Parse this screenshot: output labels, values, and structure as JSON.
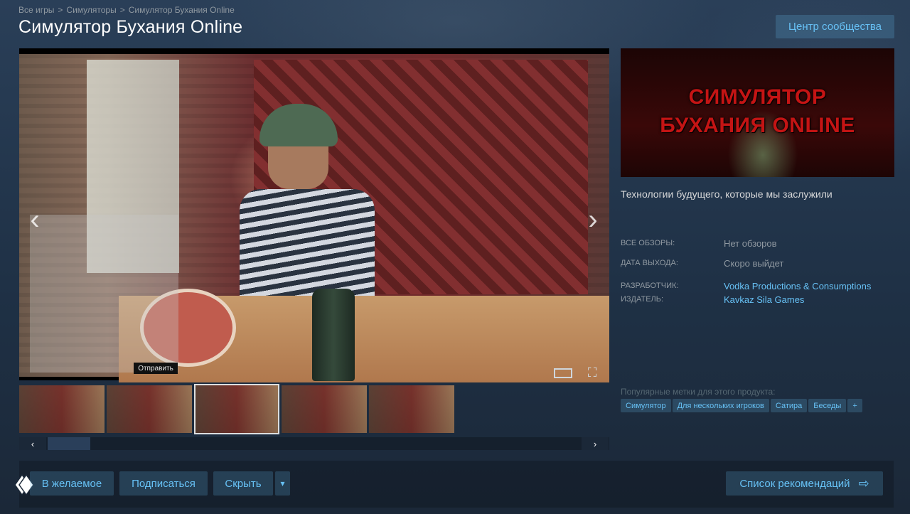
{
  "breadcrumb": {
    "items": [
      "Все игры",
      "Симуляторы",
      "Симулятор Бухания Online"
    ],
    "separator": ">"
  },
  "page_title": "Симулятор Бухания Online",
  "community_button": "Центр сообщества",
  "player": {
    "send_label": "Отправить",
    "nav_prev_icon": "‹",
    "nav_next_icon": "›",
    "fullscreen_icon": "⛶"
  },
  "thumbnails": {
    "count": 5,
    "active_index": 2
  },
  "scroll": {
    "left_icon": "‹",
    "right_icon": "›"
  },
  "capsule": {
    "line1": "СИМУЛЯТОР",
    "line2": "БУХАНИЯ ONLINE"
  },
  "description": "Технологии будущего, которые мы заслужили",
  "info": {
    "reviews_label": "ВСЕ ОБЗОРЫ:",
    "reviews_value": "Нет обзоров",
    "release_label": "ДАТА ВЫХОДА:",
    "release_value": "Скоро выйдет",
    "developer_label": "РАЗРАБОТЧИК:",
    "developer_value": "Vodka Productions & Consumptions",
    "publisher_label": "ИЗДАТЕЛЬ:",
    "publisher_value": "Kavkaz Sila Games"
  },
  "tags": {
    "title": "Популярные метки для этого продукта:",
    "items": [
      "Симулятор",
      "Для нескольких игроков",
      "Сатира",
      "Беседы",
      "+"
    ]
  },
  "actions": {
    "wishlist": "В желаемое",
    "follow": "Подписаться",
    "ignore": "Скрыть",
    "ignore_dropdown_icon": "▾",
    "queue": "Список рекомендаций",
    "queue_icon": "⇨"
  },
  "colors": {
    "accent": "#67c1f5",
    "capsule_title": "#c41414"
  }
}
